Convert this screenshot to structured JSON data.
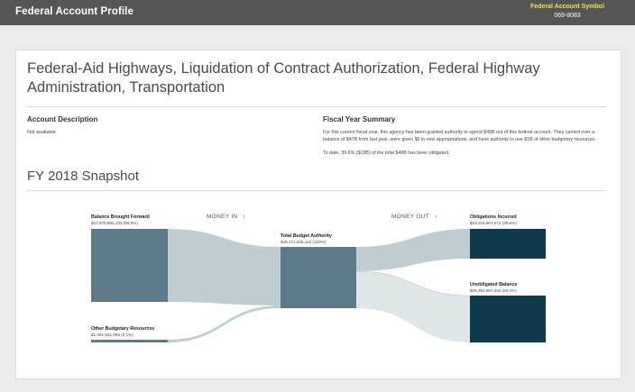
{
  "header": {
    "title": "Federal Account Profile",
    "symbol_label": "Federal Account Symbol",
    "symbol_value": "069-8083"
  },
  "account": {
    "name": "Federal-Aid Highways, Liquidation of Contract Authorization, Federal Highway Administration, Transportation",
    "description_title": "Account Description",
    "description_text": "Not available",
    "fy_summary_title": "Fiscal Year Summary",
    "fy_summary_text": "For this current fiscal year, this agency has been granted authority to spend $49B out of this federal account. They carried over a balance of $47B from last year, were given $0 in new appropriations, and have authority to use $1B of other budgetary resources.",
    "fy_summary_text2": "To date, 39.6% ($19B) of the total $49B has been obligated."
  },
  "snapshot": {
    "title": "FY 2018 Snapshot",
    "money_in": "MONEY IN",
    "money_out": "MONEY OUT",
    "arrow": "›"
  },
  "sankey": {
    "balance_forward": {
      "label": "Balance Brought Forward",
      "value": "$47,879,993,133 (96.9%)"
    },
    "other_resources": {
      "label": "Other Budgetary Resources",
      "value": "$1,491,641,983 (3.1%)"
    },
    "total_authority": {
      "label": "Total Budget Authority",
      "value": "$49,371,635,116 (100%)"
    },
    "obligations": {
      "label": "Obligations Incurred",
      "value": "$19,216,967,672 (39.6%)"
    },
    "unobligated": {
      "label": "Unobligated Balance",
      "value": "$29,354,667,442 (60.4%)"
    }
  },
  "colors": {
    "header_bg": "#555555",
    "symbol_label": "#e6e94a",
    "source_node": "#5d7a8a",
    "dest_node": "#0e3a4c",
    "flow": "#bfcdd1",
    "flow_light": "#dfe6e8"
  },
  "icons": {
    "money_arrow": "chevron-right-icon"
  }
}
